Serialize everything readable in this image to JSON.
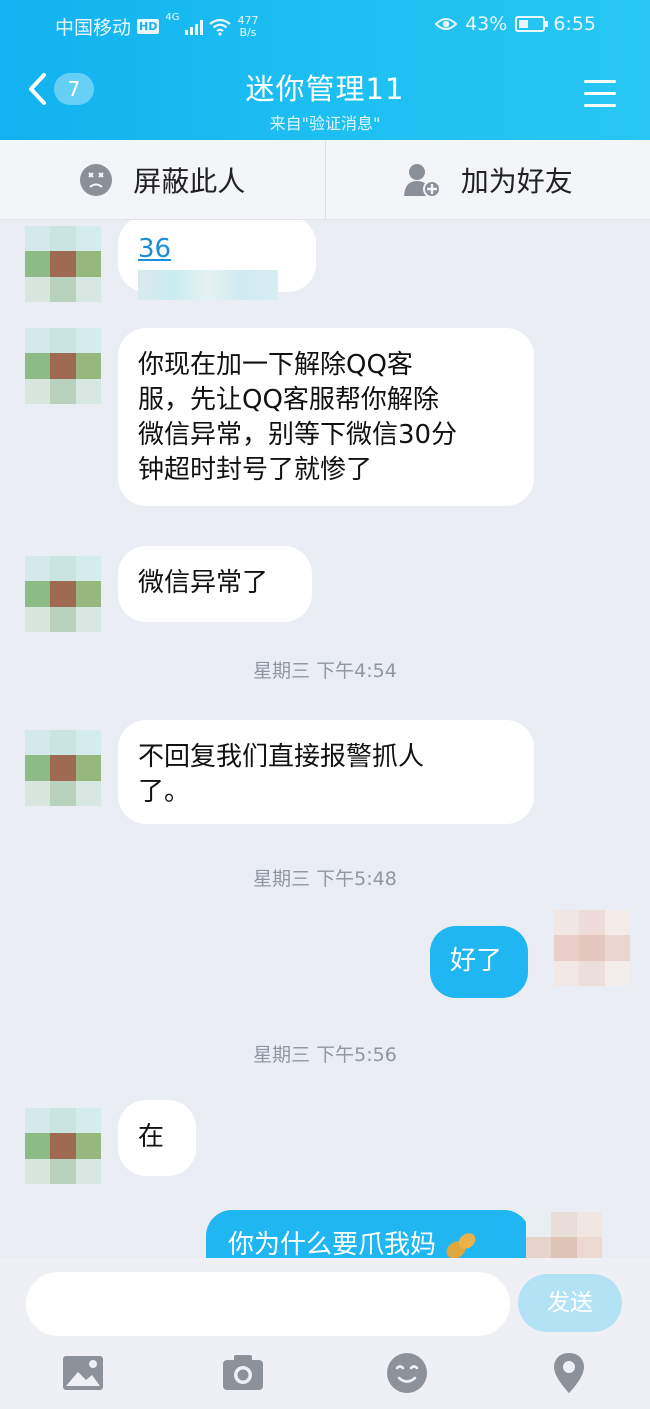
{
  "status_bar": {
    "carrier": "中国移动",
    "hd": "HD",
    "network": "4G",
    "speed_value": "477",
    "speed_unit": "B/s",
    "battery": "43%",
    "battery_level": 0.43,
    "time": "6:55"
  },
  "header": {
    "unread_count": "7",
    "title": "迷你管理11",
    "subtitle": "来自\"验证消息\""
  },
  "actions": {
    "block": "屏蔽此人",
    "add_friend": "加为好友"
  },
  "messages": [
    {
      "side": "left",
      "text_visible": "36",
      "note": "redacted link"
    },
    {
      "side": "left",
      "lines": [
        "你现在加一下解除QQ客",
        "服，先让QQ客服帮你解除",
        "微信异常，别等下微信30分",
        "钟超时封号了就惨了"
      ]
    },
    {
      "side": "left",
      "text": "微信异常了"
    },
    {
      "type": "time",
      "text": "星期三 下午4:54"
    },
    {
      "side": "left",
      "lines": [
        "不回复我们直接报警抓人",
        "了。"
      ]
    },
    {
      "type": "time",
      "text": "星期三 下午5:48"
    },
    {
      "side": "right",
      "text": "好了"
    },
    {
      "type": "time",
      "text": "星期三 下午5:56"
    },
    {
      "side": "left",
      "text": "在"
    },
    {
      "side": "right",
      "text": "你为什么要爪我妈"
    }
  ],
  "input": {
    "placeholder": "",
    "send": "发送"
  },
  "colors": {
    "header": "#1fbdf2",
    "self_bubble": "#1fb6f2",
    "background": "#eaedf4"
  }
}
